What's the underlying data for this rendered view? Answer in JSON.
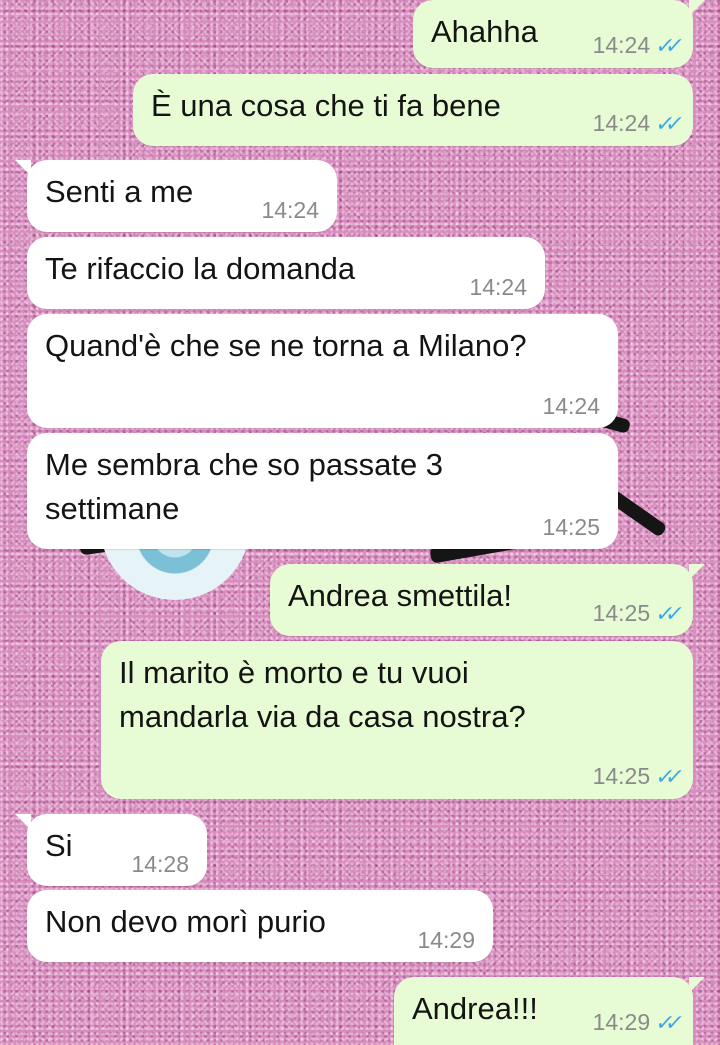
{
  "chat": {
    "messages": [
      {
        "direction": "out",
        "text": "Ahahha",
        "time": "14:24",
        "status": "read"
      },
      {
        "direction": "out",
        "text": "È una cosa che ti fa bene",
        "time": "14:24",
        "status": "read"
      },
      {
        "direction": "in",
        "text": "Senti a me",
        "time": "14:24"
      },
      {
        "direction": "in",
        "text": "Te rifaccio la domanda",
        "time": "14:24"
      },
      {
        "direction": "in",
        "text": "Quand'è che se ne torna a Milano?",
        "time": "14:24"
      },
      {
        "direction": "in",
        "text": "Me sembra che so passate 3\nsettimane",
        "time": "14:25"
      },
      {
        "direction": "out",
        "text": "Andrea smettila!",
        "time": "14:25",
        "status": "read"
      },
      {
        "direction": "out",
        "text": "Il marito è morto e tu vuoi\nmandarla via da casa nostra?",
        "time": "14:25",
        "status": "read"
      },
      {
        "direction": "in",
        "text": "Si",
        "time": "14:28"
      },
      {
        "direction": "in",
        "text": "Non devo morì purio",
        "time": "14:29"
      },
      {
        "direction": "out",
        "text": "Andrea!!!",
        "time": "14:29",
        "status": "read"
      }
    ],
    "read_tick_icon": "double-check-icon",
    "colors": {
      "incoming_bubble": "#ffffff",
      "outgoing_bubble": "#e7fcd4",
      "timestamp": "#8a8a8a",
      "read_ticks": "#3ea7e8",
      "wallpaper": "#d98bbf"
    }
  }
}
